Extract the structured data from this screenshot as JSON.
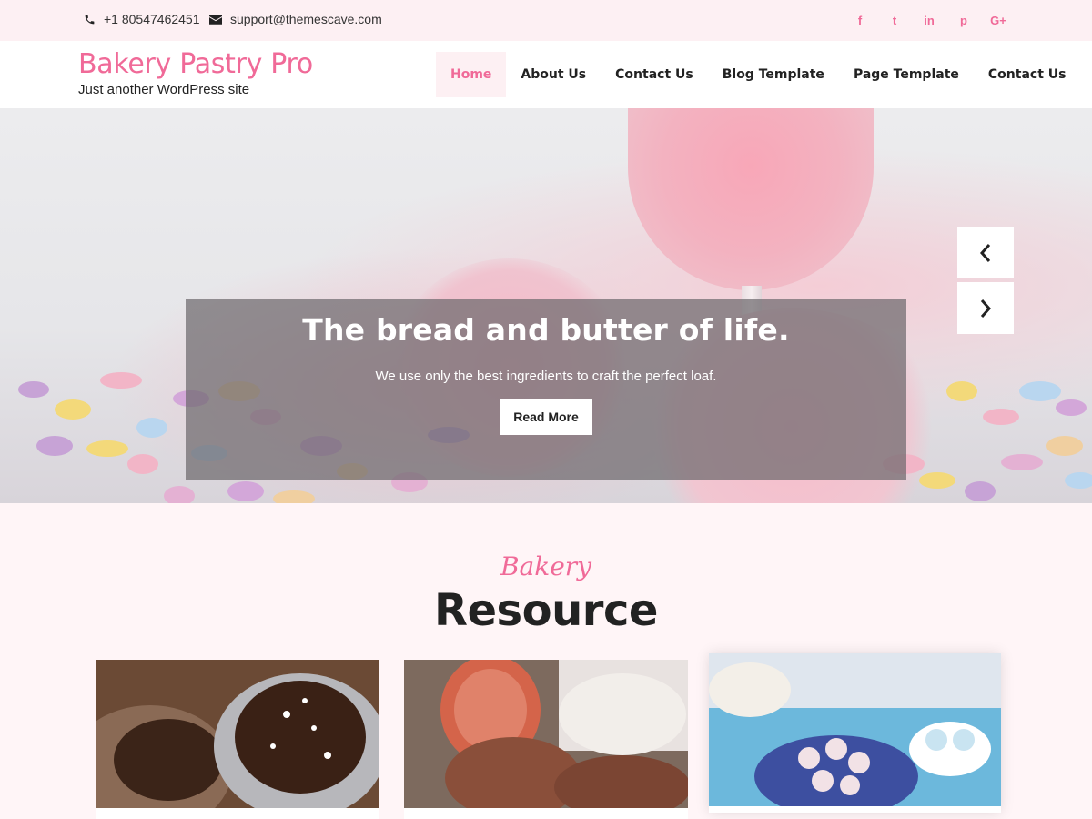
{
  "topbar": {
    "phone": "+1 80547462451",
    "email": "support@themescave.com",
    "social": [
      {
        "icon": "facebook-icon",
        "glyph": "f"
      },
      {
        "icon": "twitter-icon",
        "glyph": "t"
      },
      {
        "icon": "linkedin-icon",
        "glyph": "in"
      },
      {
        "icon": "pinterest-icon",
        "glyph": "p"
      },
      {
        "icon": "google-plus-icon",
        "glyph": "G+"
      }
    ]
  },
  "header": {
    "site_title": "Bakery Pastry Pro",
    "tagline": "Just another WordPress site"
  },
  "nav": {
    "items": [
      "Home",
      "About Us",
      "Contact Us",
      "Blog Template",
      "Page Template",
      "Contact Us"
    ]
  },
  "hero": {
    "title": "The bread and butter of life.",
    "text": "We use only the best ingredients to craft the perfect loaf.",
    "button": "Read More"
  },
  "section": {
    "subtitle": "Bakery",
    "title": "Resource"
  },
  "colors": {
    "accent": "#f06a98",
    "topbar_bg": "#fdf0f3",
    "page_bg": "#fff5f7"
  }
}
